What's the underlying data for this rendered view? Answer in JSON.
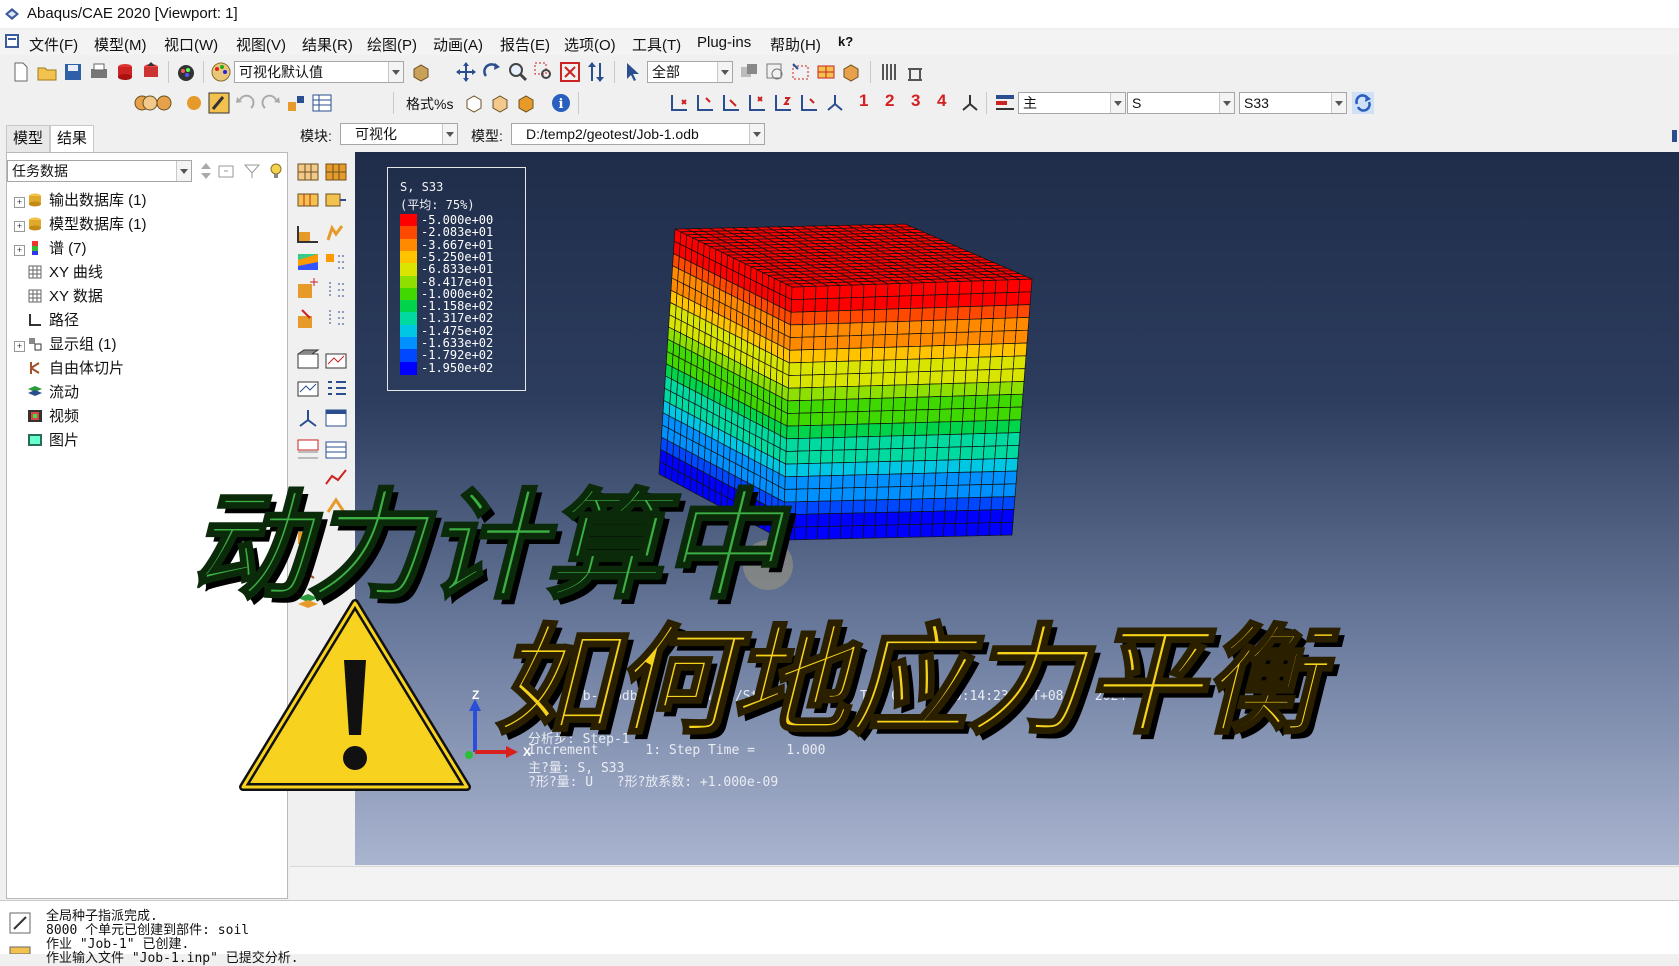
{
  "window": {
    "title": "Abaqus/CAE 2020 [Viewport: 1]"
  },
  "menu": [
    "文件(F)",
    "模型(M)",
    "视口(W)",
    "视图(V)",
    "结果(R)",
    "绘图(P)",
    "动画(A)",
    "报告(E)",
    "选项(O)",
    "工具(T)",
    "Plug-ins",
    "帮助(H)",
    "k?"
  ],
  "toolbar": {
    "defaults_combo": "可视化默认值",
    "selection_combo": "全部",
    "format_label": "格式%s",
    "primary_combo": "主",
    "variable_combo": "S",
    "component_combo": "S33",
    "view_numbers": [
      "1",
      "2",
      "3",
      "4"
    ]
  },
  "context": {
    "module_label": "模块:",
    "module_value": "可视化",
    "model_label": "模型:",
    "model_value": "D:/temp2/geotest/Job-1.odb"
  },
  "left_panel": {
    "tabs": [
      "模型",
      "结果"
    ],
    "combo": "任务数据",
    "tree": [
      {
        "label": "输出数据库 (1)",
        "icon": "database-icon",
        "expandable": true
      },
      {
        "label": "模型数据库 (1)",
        "icon": "database-icon",
        "expandable": true
      },
      {
        "label": "谱 (7)",
        "icon": "spectrum-icon",
        "expandable": true
      },
      {
        "label": "XY 曲线",
        "icon": "grid-icon",
        "expandable": false
      },
      {
        "label": "XY 数据",
        "icon": "grid-icon",
        "expandable": false
      },
      {
        "label": "路径",
        "icon": "path-icon",
        "expandable": false
      },
      {
        "label": "显示组 (1)",
        "icon": "display-group-icon",
        "expandable": true
      },
      {
        "label": "自由体切片",
        "icon": "free-body-icon",
        "expandable": false
      },
      {
        "label": "流动",
        "icon": "stream-icon",
        "expandable": false
      },
      {
        "label": "视频",
        "icon": "movie-icon",
        "expandable": false
      },
      {
        "label": "图片",
        "icon": "image-icon",
        "expandable": false
      }
    ]
  },
  "legend": {
    "title": "S, S33",
    "subtitle": "(平均: 75%)",
    "entries": [
      {
        "value": "-5.000e+00",
        "color": "#ff0000"
      },
      {
        "value": "-2.083e+01",
        "color": "#ff4800"
      },
      {
        "value": "-3.667e+01",
        "color": "#ff8a00"
      },
      {
        "value": "-5.250e+01",
        "color": "#ffc300"
      },
      {
        "value": "-6.833e+01",
        "color": "#d9e400"
      },
      {
        "value": "-8.417e+01",
        "color": "#8ee000"
      },
      {
        "value": "-1.000e+02",
        "color": "#3fd800"
      },
      {
        "value": "-1.158e+02",
        "color": "#00d44a"
      },
      {
        "value": "-1.317e+02",
        "color": "#00d9a0"
      },
      {
        "value": "-1.475e+02",
        "color": "#00c8e4"
      },
      {
        "value": "-1.633e+02",
        "color": "#0090ff"
      },
      {
        "value": "-1.792e+02",
        "color": "#0048ff"
      },
      {
        "value": "-1.950e+02",
        "color": "#0000ff"
      }
    ]
  },
  "viewport_info": {
    "odb": "ODB: Job-1.odb",
    "solver": "Abaqus/Standard 2020",
    "date": "Tue Oct 22 20:14:23 GMT+08:00 2024",
    "step": "分析步: Step-1",
    "increment": "Increment      1: Step Time =    1.000",
    "primary": "主?量: S, S33",
    "deformed": "?形?量: U   ?形?放系数: +1.000e-09"
  },
  "triad": {
    "z": "Z",
    "x": "X"
  },
  "overlay": {
    "line1": "动力计算中",
    "line2": "如何地应力平衡",
    "line1_color": "#3cb043",
    "line2_color": "#f6d21a"
  },
  "messages": [
    "全局种子指派完成.",
    "8000 个单元已创建到部件: soil",
    "作业 \"Job-1\" 已创建.",
    "作业输入文件 \"Job-1.inp\" 已提交分析."
  ]
}
